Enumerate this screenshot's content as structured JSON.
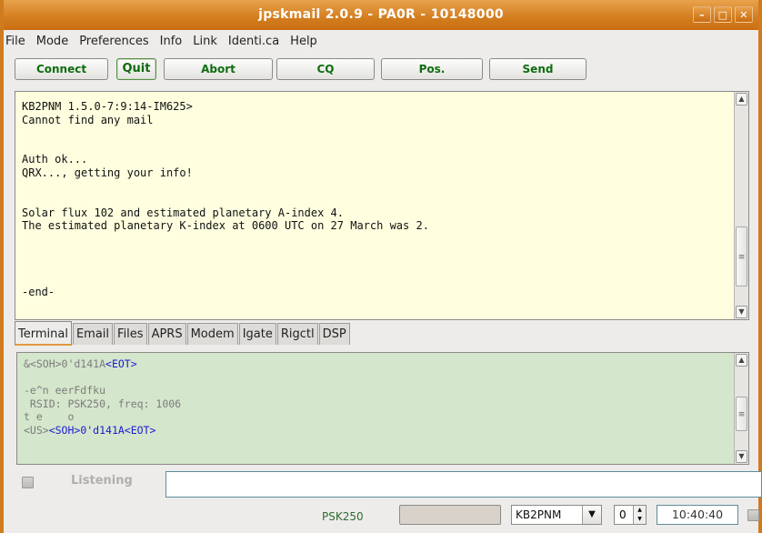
{
  "window": {
    "title": "jpskmail 2.0.9 - PA0R - 10148000",
    "controls": [
      "minimize-icon",
      "maximize-icon",
      "close-icon"
    ]
  },
  "menu": [
    "File",
    "Mode",
    "Preferences",
    "Info",
    "Link",
    "Identi.ca",
    "Help"
  ],
  "toolbar": {
    "connect": "Connect",
    "quit": "Quit",
    "abort": "Abort",
    "cq": "CQ",
    "pos": "Pos.",
    "send": "Send"
  },
  "terminal": {
    "lines": [
      "KB2PNM 1.5.0-7:9:14-IM625>",
      "Cannot find any mail",
      "",
      "",
      "Auth ok...",
      "QRX..., getting your info!",
      "",
      "",
      "Solar flux 102 and estimated planetary A-index 4.",
      "The estimated planetary K-index at 0600 UTC on 27 March was 2.",
      "",
      "",
      "",
      "",
      "-end-"
    ]
  },
  "tabs": [
    "Terminal",
    "Email",
    "Files",
    "APRS",
    "Modem",
    "Igate",
    "Rigctl",
    "DSP"
  ],
  "active_tab": "Terminal",
  "rx_monitor": {
    "line1_a": "&<SOH>0'd141A",
    "line1_b": "<EOT>",
    "line2": "",
    "line3": "-e^n eerFdfku",
    "line4": " RSID: PSK250, freq: 1006",
    "line5": "t e    o",
    "line6_a": "<US>",
    "line6_b": "<SOH>0'd141A<EOT>"
  },
  "status": {
    "listening": "Listening",
    "mode": "PSK250",
    "callsign": "KB2PNM",
    "spin_value": "0",
    "clock": "10:40:40"
  },
  "colors": {
    "titlebar": "#d37d1e",
    "terminal_bg": "#ffffe0",
    "rx_bg": "#d4e6cb",
    "button_text": "#0f6d0f",
    "rx_highlight": "#1b1bd4"
  }
}
